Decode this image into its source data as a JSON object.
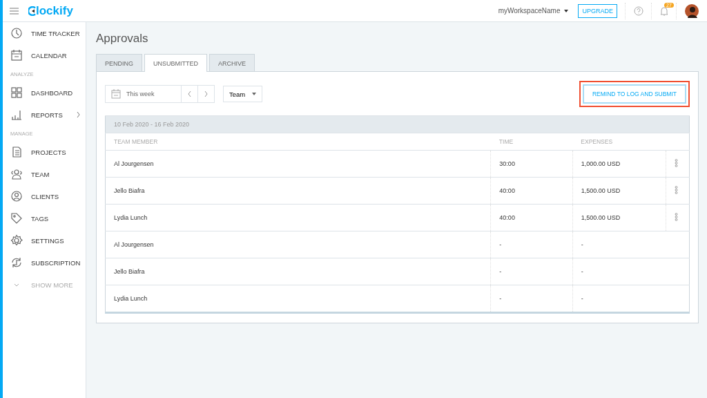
{
  "header": {
    "logo": "lockify",
    "workspace": "myWorkspaceName",
    "upgrade": "UPGRADE",
    "notifications": "27"
  },
  "sidebar": [
    {
      "kind": "item",
      "label": "TIME TRACKER"
    },
    {
      "kind": "item",
      "label": "CALENDAR"
    },
    {
      "kind": "section",
      "label": "ANALYZE"
    },
    {
      "kind": "item",
      "label": "DASHBOARD"
    },
    {
      "kind": "item",
      "label": "REPORTS",
      "expandable": true
    },
    {
      "kind": "section",
      "label": "MANAGE"
    },
    {
      "kind": "item",
      "label": "PROJECTS"
    },
    {
      "kind": "item",
      "label": "TEAM"
    },
    {
      "kind": "item",
      "label": "CLIENTS"
    },
    {
      "kind": "item",
      "label": "TAGS"
    },
    {
      "kind": "item",
      "label": "SETTINGS"
    },
    {
      "kind": "item",
      "label": "SUBSCRIPTION"
    },
    {
      "kind": "more",
      "label": "SHOW MORE"
    }
  ],
  "page": {
    "title": "Approvals",
    "tabs": [
      {
        "label": "PENDING",
        "selected": false
      },
      {
        "label": "UNSUBMITTED",
        "selected": true
      },
      {
        "label": "ARCHIVE",
        "selected": false
      }
    ],
    "date_range": "This week",
    "filter": "Team",
    "remind_button": {
      "label": "REMIND TO LOG AND SUBMIT",
      "highlighted": true
    },
    "table": {
      "period": "10 Feb 2020 - 16 Feb 2020",
      "columns": [
        "TEAM MEMBER",
        "TIME",
        "EXPENSES"
      ],
      "rows": [
        {
          "member": "Al Jourgensen",
          "time": "30:00",
          "expenses": "1,000.00 USD",
          "menu": true
        },
        {
          "member": "Jello Biafra",
          "time": "40:00",
          "expenses": "1,500.00 USD",
          "menu": true
        },
        {
          "member": "Lydia Lunch",
          "time": "40:00",
          "expenses": "1,500.00 USD",
          "menu": true
        },
        {
          "member": "Al Jourgensen",
          "time": "-",
          "expenses": "-",
          "menu": false
        },
        {
          "member": "Jello Biafra",
          "time": "-",
          "expenses": "-",
          "menu": false
        },
        {
          "member": "Lydia Lunch",
          "time": "-",
          "expenses": "-",
          "menu": false
        }
      ]
    }
  }
}
